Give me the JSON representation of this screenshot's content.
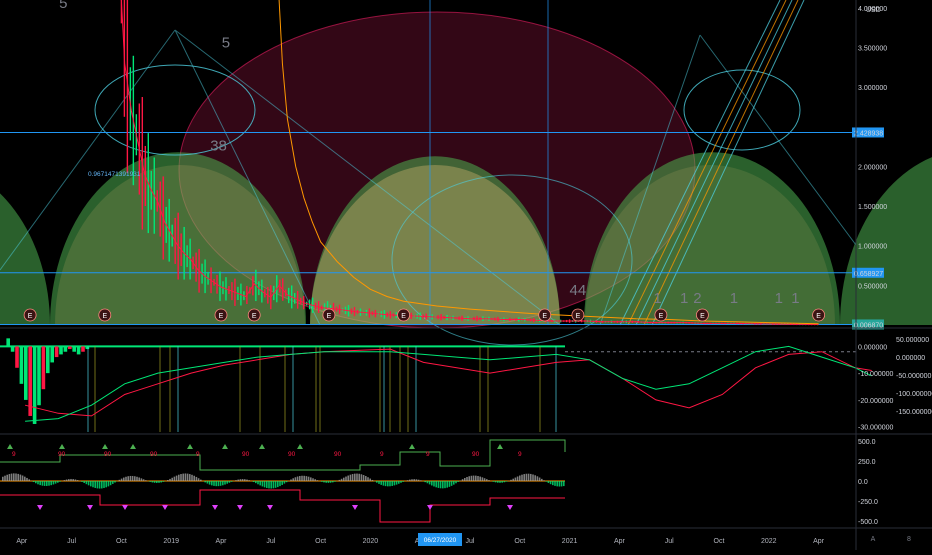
{
  "currency": "USD",
  "crosshair_date": "06/27/2020",
  "fib_label": "0.9671471391931",
  "colors": {
    "background": "#000000",
    "green_arc": "#4caf50",
    "red_arc": "#e91e63",
    "tan_arc": "#ffcc80",
    "price_green": "#00e676",
    "price_red": "#ff1744",
    "cyan": "#4dd0e1",
    "blue_line": "#2196f3",
    "hline_fill": "#2196f3",
    "last_price_fill": "#26a69a",
    "orange": "#ff9800",
    "magenta": "#e040fb"
  },
  "chart_data": [
    {
      "type": "line",
      "panel": "price",
      "ylim": [
        0,
        4.1
      ],
      "y_ticks": [
        "4.000000",
        "3.500000",
        "3.000000",
        "2.000000",
        "1.500000",
        "1.000000",
        "0.500000"
      ],
      "y_tick_values": [
        4.0,
        3.5,
        3.0,
        2.0,
        1.5,
        1.0,
        0.5
      ],
      "highlight_levels": [
        {
          "label": "2.428938",
          "value": 2.428938
        },
        {
          "label": "0.658927",
          "value": 0.658927
        },
        {
          "label": "0.006870",
          "value": 0.00687
        }
      ],
      "x_ticks": [
        "Apr",
        "Jul",
        "Oct",
        "2019",
        "Apr",
        "Jul",
        "Oct",
        "2020",
        "Apr",
        "Jul",
        "Oct",
        "2021",
        "Apr",
        "Jul",
        "Oct",
        "2022",
        "Apr"
      ],
      "x_tick_months": [
        3,
        6,
        9,
        12,
        15,
        18,
        21,
        24,
        27,
        30,
        33,
        36,
        39,
        42,
        45,
        48,
        51
      ],
      "wave_labels": [
        {
          "text": "5",
          "month": 5.5,
          "value": 4.0
        },
        {
          "text": "5",
          "month": 15.3,
          "value": 3.5
        },
        {
          "text": "3",
          "month": 14.6,
          "value": 2.2
        },
        {
          "text": "8",
          "month": 15.1,
          "value": 2.2
        },
        {
          "text": "44",
          "month": 36.5,
          "value": 0.38
        },
        {
          "text": "1",
          "month": 41.3,
          "value": 0.28
        },
        {
          "text": "1",
          "month": 42.9,
          "value": 0.28
        },
        {
          "text": "2",
          "month": 43.7,
          "value": 0.28
        },
        {
          "text": "1",
          "month": 45.9,
          "value": 0.28
        },
        {
          "text": "1",
          "month": 48.6,
          "value": 0.28
        },
        {
          "text": "1",
          "month": 49.6,
          "value": 0.28
        }
      ],
      "earnings_markers_months": [
        3.5,
        8,
        15,
        17,
        21.5,
        26,
        34.5,
        36.5,
        41.5,
        44,
        51
      ],
      "earnings_label": "E",
      "series": [
        {
          "name": "",
          "values": [
            [
              9.0,
              4.1
            ],
            [
              9.2,
              3.3
            ],
            [
              9.6,
              2.7
            ],
            [
              10.0,
              2.3
            ],
            [
              10.4,
              1.9
            ],
            [
              10.8,
              1.7
            ],
            [
              11.2,
              1.55
            ],
            [
              11.6,
              1.3
            ],
            [
              12.0,
              1.15
            ],
            [
              12.4,
              1.0
            ],
            [
              12.8,
              0.9
            ],
            [
              13.2,
              0.82
            ],
            [
              13.6,
              0.7
            ],
            [
              14.0,
              0.62
            ],
            [
              14.5,
              0.55
            ],
            [
              15.0,
              0.48
            ],
            [
              15.5,
              0.44
            ],
            [
              16.0,
              0.4
            ],
            [
              16.5,
              0.36
            ],
            [
              17.0,
              0.52
            ],
            [
              17.5,
              0.42
            ],
            [
              18.0,
              0.35
            ],
            [
              18.5,
              0.5
            ],
            [
              19.0,
              0.38
            ],
            [
              19.5,
              0.33
            ],
            [
              20.0,
              0.28
            ],
            [
              20.5,
              0.25
            ],
            [
              21.0,
              0.22
            ],
            [
              22.0,
              0.2
            ],
            [
              23.0,
              0.17
            ],
            [
              24.0,
              0.15
            ],
            [
              25.0,
              0.13
            ],
            [
              26.0,
              0.12
            ],
            [
              27.0,
              0.11
            ],
            [
              28.0,
              0.1
            ],
            [
              29.0,
              0.09
            ],
            [
              30.0,
              0.08
            ],
            [
              31.0,
              0.08
            ],
            [
              32.0,
              0.07
            ],
            [
              33.0,
              0.07
            ],
            [
              34.0,
              0.06
            ],
            [
              35.0,
              0.05
            ],
            [
              36.0,
              0.05
            ],
            [
              37.0,
              0.05
            ],
            [
              38.0,
              0.04
            ],
            [
              39.0,
              0.04
            ],
            [
              40.0,
              0.04
            ],
            [
              41.0,
              0.03
            ],
            [
              42.0,
              0.03
            ],
            [
              43.0,
              0.03
            ],
            [
              44.0,
              0.02
            ],
            [
              45.0,
              0.02
            ],
            [
              46.0,
              0.02
            ],
            [
              47.0,
              0.015
            ],
            [
              48.0,
              0.012
            ],
            [
              49.0,
              0.01
            ],
            [
              50.0,
              0.008
            ],
            [
              51.0,
              0.00687
            ]
          ]
        },
        {
          "name": "",
          "values": [
            [
              18.5,
              4.1
            ],
            [
              18.7,
              3.3
            ],
            [
              19.0,
              2.6
            ],
            [
              19.5,
              2.0
            ],
            [
              20.0,
              1.6
            ],
            [
              20.5,
              1.3
            ],
            [
              21.0,
              1.05
            ],
            [
              22.0,
              0.8
            ],
            [
              23.0,
              0.6
            ],
            [
              24.0,
              0.45
            ],
            [
              25.0,
              0.36
            ],
            [
              26.0,
              0.3
            ],
            [
              28.0,
              0.24
            ],
            [
              30.0,
              0.2
            ],
            [
              32.0,
              0.17
            ],
            [
              34.0,
              0.14
            ],
            [
              36.0,
              0.12
            ],
            [
              38.0,
              0.1
            ],
            [
              40.0,
              0.08
            ],
            [
              42.0,
              0.07
            ],
            [
              44.0,
              0.05
            ],
            [
              46.0,
              0.04
            ],
            [
              48.0,
              0.03
            ],
            [
              50.0,
              0.02
            ],
            [
              51.0,
              0.015
            ]
          ]
        }
      ]
    },
    {
      "type": "line",
      "panel": "oscillator",
      "ylim": [
        -32,
        5
      ],
      "left_y_ticks": [
        "0.000000",
        "-10.000000",
        "-20.000000",
        "-30.000000"
      ],
      "left_y_values": [
        0,
        -10,
        -20,
        -30
      ],
      "right_y_ticks": [
        "50.000000",
        "0.000000",
        "-50.000000",
        "-100.000000",
        "-150.000000"
      ],
      "right_y_values": [
        50,
        0,
        -50,
        -100,
        -150
      ],
      "series": [
        {
          "name": "",
          "values": [
            [
              0,
              -22
            ],
            [
              2,
              -25
            ],
            [
              4,
              -26
            ],
            [
              6,
              -18
            ],
            [
              8,
              -14
            ],
            [
              10,
              -10
            ],
            [
              12,
              -7
            ],
            [
              14,
              -5
            ],
            [
              16,
              -3
            ],
            [
              18,
              -2
            ],
            [
              20,
              -1.5
            ],
            [
              22,
              -1
            ],
            [
              24,
              -6
            ],
            [
              26,
              -8
            ],
            [
              28,
              -10
            ],
            [
              30,
              -8
            ],
            [
              32,
              -6
            ],
            [
              34,
              -5
            ],
            [
              36,
              -12
            ],
            [
              38,
              -20
            ],
            [
              40,
              -23
            ],
            [
              42,
              -18
            ],
            [
              44,
              -8
            ],
            [
              46,
              -3
            ],
            [
              48,
              -2
            ],
            [
              50,
              -8
            ],
            [
              51,
              -9
            ]
          ]
        },
        {
          "name": "",
          "values": [
            [
              0,
              -28
            ],
            [
              2,
              -27
            ],
            [
              4,
              -22
            ],
            [
              6,
              -14
            ],
            [
              8,
              -10
            ],
            [
              10,
              -8
            ],
            [
              12,
              -6
            ],
            [
              14,
              -4
            ],
            [
              16,
              -3
            ],
            [
              18,
              -2
            ],
            [
              20,
              -2
            ],
            [
              22,
              -2
            ],
            [
              24,
              -3
            ],
            [
              26,
              -4
            ],
            [
              28,
              -5
            ],
            [
              30,
              -4
            ],
            [
              32,
              -3
            ],
            [
              34,
              -5
            ],
            [
              36,
              -12
            ],
            [
              38,
              -16
            ],
            [
              40,
              -14
            ],
            [
              42,
              -8
            ],
            [
              44,
              -2
            ],
            [
              46,
              0
            ],
            [
              48,
              -4
            ],
            [
              50,
              -8
            ],
            [
              51,
              -11
            ]
          ]
        }
      ],
      "histogram_start": [
        0,
        3,
        -2,
        -8,
        -14,
        -20,
        -26,
        -29,
        -22,
        -16,
        -10,
        -6,
        -4,
        -3,
        -2,
        -1,
        -2,
        -3,
        -2,
        -1
      ]
    },
    {
      "type": "line",
      "panel": "signals",
      "ylim": [
        -560,
        560
      ],
      "y_ticks": [
        "500.0",
        "250.0",
        "0.0",
        "-250.0",
        "-500.0"
      ],
      "y_tick_values": [
        500,
        250,
        0,
        -250,
        -500
      ],
      "signal_labels": [
        "9",
        "90",
        "90",
        "90",
        "9",
        "90",
        "90",
        "90",
        "9",
        "9",
        "90",
        "9"
      ]
    }
  ]
}
